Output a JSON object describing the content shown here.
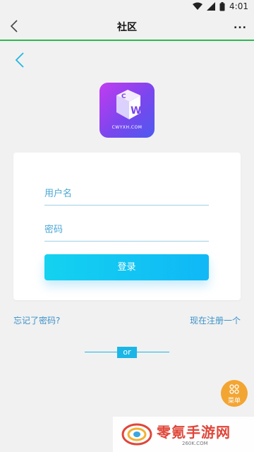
{
  "status_bar": {
    "time": "4:01"
  },
  "top_bar": {
    "title": "社区",
    "more": "..."
  },
  "colors": {
    "accent": "#14c3f0",
    "progress": "#2db84d",
    "link": "#3b91c9",
    "fab": "#f3a532"
  },
  "logo": {
    "site_text": "CWYXH.COM"
  },
  "login": {
    "username_placeholder": "用户名",
    "password_placeholder": "密码",
    "submit_label": "登录"
  },
  "links": {
    "forgot": "忘记了密码?",
    "register": "现在注册一个"
  },
  "divider": {
    "label": "or"
  },
  "fab": {
    "label": "菜单"
  },
  "watermark": {
    "brand": "零氪手游网",
    "domain": "260K.COM"
  }
}
